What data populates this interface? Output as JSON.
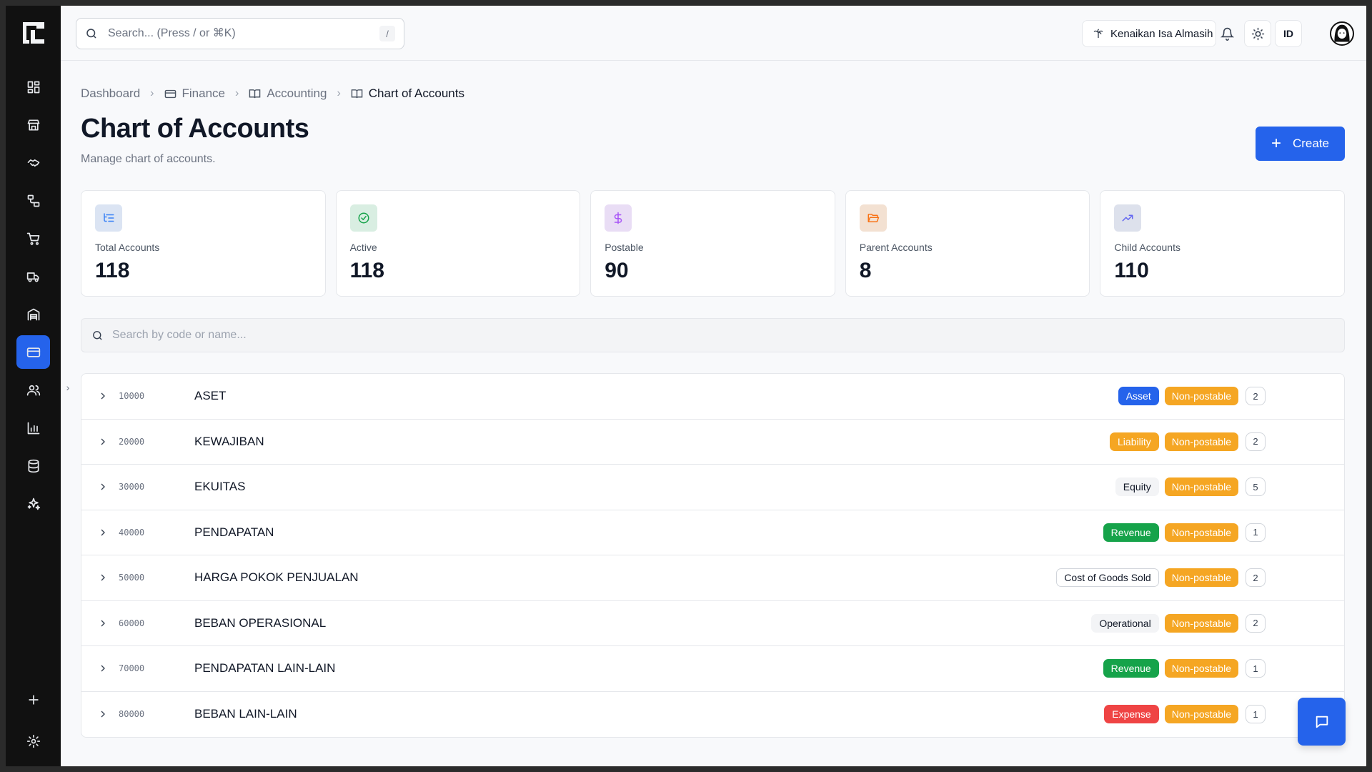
{
  "sidebar": {
    "items": [
      {
        "icon": "dashboard-grid-icon",
        "active": false
      },
      {
        "icon": "store-icon",
        "active": false
      },
      {
        "icon": "handshake-icon",
        "active": false
      },
      {
        "icon": "workflow-icon",
        "active": false
      },
      {
        "icon": "shopping-cart-icon",
        "active": false
      },
      {
        "icon": "truck-icon",
        "active": false
      },
      {
        "icon": "warehouse-icon",
        "active": false
      },
      {
        "icon": "credit-card-icon",
        "active": true
      },
      {
        "icon": "users-icon",
        "active": false
      },
      {
        "icon": "bar-chart-icon",
        "active": false
      },
      {
        "icon": "database-icon",
        "active": false
      },
      {
        "icon": "sparkles-icon",
        "active": false
      }
    ],
    "bottom": [
      {
        "icon": "plus-icon"
      },
      {
        "icon": "gear-icon"
      }
    ]
  },
  "topbar": {
    "search_placeholder": "Search... (Press / or ⌘K)",
    "search_shortcut": "/",
    "company": "Kenaikan Isa Almasih",
    "language": "ID"
  },
  "breadcrumb": {
    "items": [
      {
        "label": "Dashboard",
        "icon": ""
      },
      {
        "label": "Finance",
        "icon": "wallet-icon"
      },
      {
        "label": "Accounting",
        "icon": "book-open-icon"
      },
      {
        "label": "Chart of Accounts",
        "icon": "book-open-icon"
      }
    ]
  },
  "page": {
    "title": "Chart of Accounts",
    "subtitle": "Manage chart of accounts.",
    "create_label": "Create"
  },
  "stats": [
    {
      "label": "Total Accounts",
      "value": "118",
      "icon": "list-tree-icon",
      "bg": "#dbe4f3",
      "color": "#3b82f6"
    },
    {
      "label": "Active",
      "value": "118",
      "icon": "check-circle-icon",
      "bg": "#d9eee2",
      "color": "#16a34a"
    },
    {
      "label": "Postable",
      "value": "90",
      "icon": "dollar-icon",
      "bg": "#e9ddf5",
      "color": "#a855f7"
    },
    {
      "label": "Parent Accounts",
      "value": "8",
      "icon": "folder-open-icon",
      "bg": "#f3e1d2",
      "color": "#f97316"
    },
    {
      "label": "Child Accounts",
      "value": "110",
      "icon": "trending-up-icon",
      "bg": "#dde1ec",
      "color": "#6366f1"
    }
  ],
  "filter": {
    "placeholder": "Search by code or name..."
  },
  "accounts": [
    {
      "code": "10000",
      "name": "ASET",
      "type": "Asset",
      "type_bg": "#2563eb",
      "type_fg": "#ffffff",
      "type_border": "#2563eb",
      "posting": "Non-postable",
      "children": "2"
    },
    {
      "code": "20000",
      "name": "KEWAJIBAN",
      "type": "Liability",
      "type_bg": "#f5a623",
      "type_fg": "#ffffff",
      "type_border": "#f5a623",
      "posting": "Non-postable",
      "children": "2"
    },
    {
      "code": "30000",
      "name": "EKUITAS",
      "type": "Equity",
      "type_bg": "#f3f4f6",
      "type_fg": "#111827",
      "type_border": "#f3f4f6",
      "posting": "Non-postable",
      "children": "5"
    },
    {
      "code": "40000",
      "name": "PENDAPATAN",
      "type": "Revenue",
      "type_bg": "#16a34a",
      "type_fg": "#ffffff",
      "type_border": "#16a34a",
      "posting": "Non-postable",
      "children": "1"
    },
    {
      "code": "50000",
      "name": "HARGA POKOK PENJUALAN",
      "type": "Cost of Goods Sold",
      "type_bg": "#ffffff",
      "type_fg": "#111827",
      "type_border": "#d1d5db",
      "posting": "Non-postable",
      "children": "2"
    },
    {
      "code": "60000",
      "name": "BEBAN OPERASIONAL",
      "type": "Operational",
      "type_bg": "#f3f4f6",
      "type_fg": "#111827",
      "type_border": "#f3f4f6",
      "posting": "Non-postable",
      "children": "2"
    },
    {
      "code": "70000",
      "name": "PENDAPATAN LAIN-LAIN",
      "type": "Revenue",
      "type_bg": "#16a34a",
      "type_fg": "#ffffff",
      "type_border": "#16a34a",
      "posting": "Non-postable",
      "children": "1"
    },
    {
      "code": "80000",
      "name": "BEBAN LAIN-LAIN",
      "type": "Expense",
      "type_bg": "#ef4444",
      "type_fg": "#ffffff",
      "type_border": "#ef4444",
      "posting": "Non-postable",
      "children": "1"
    }
  ],
  "colors": {
    "accent": "#2563eb",
    "non_postable": "#f5a623"
  }
}
